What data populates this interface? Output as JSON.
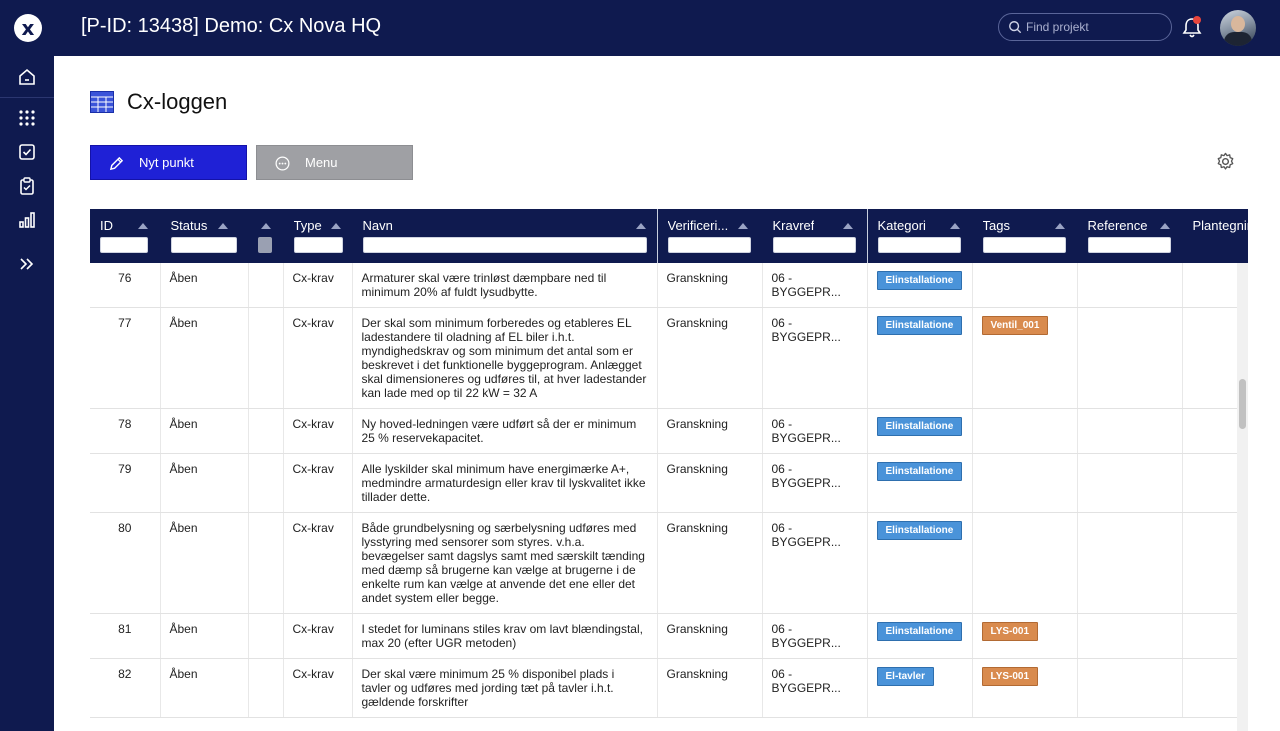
{
  "header": {
    "logo_label": "x",
    "title": "[P-ID: 13438] Demo: Cx Nova HQ",
    "search_placeholder": "Find projekt"
  },
  "page": {
    "title": "Cx-loggen"
  },
  "toolbar": {
    "new_label": "Nyt punkt",
    "menu_label": "Menu"
  },
  "table": {
    "columns": [
      {
        "label": "ID"
      },
      {
        "label": "Status"
      },
      {
        "label": ""
      },
      {
        "label": "Type"
      },
      {
        "label": "Navn"
      },
      {
        "label": "Verificeri..."
      },
      {
        "label": "Kravref"
      },
      {
        "label": "Kategori"
      },
      {
        "label": "Tags"
      },
      {
        "label": "Reference"
      },
      {
        "label": "Plantegnin"
      }
    ],
    "rows": [
      {
        "id": "76",
        "status": "Åben",
        "type": "Cx-krav",
        "name": "Armaturer skal være trinløst dæmpbare ned til minimum 20% af fuldt lysudbytte.",
        "verification": "Granskning",
        "kravref": "06 - BYGGEPR...",
        "category": "Elinstallatione",
        "tag": ""
      },
      {
        "id": "77",
        "status": "Åben",
        "type": "Cx-krav",
        "name": "Der skal som minimum forberedes og etableres EL ladestandere til oladning af EL biler i.h.t. myndighedskrav og som minimum det antal som er beskrevet i det funktionelle byggeprogram. Anlægget skal dimensioneres og udføres til, at hver ladestander kan lade med op til 22 kW = 32 A",
        "verification": "Granskning",
        "kravref": "06 - BYGGEPR...",
        "category": "Elinstallatione",
        "tag": "Ventil_001"
      },
      {
        "id": "78",
        "status": "Åben",
        "type": "Cx-krav",
        "name": "Ny hoved-ledningen være udført så der er minimum 25 % reservekapacitet.",
        "verification": "Granskning",
        "kravref": "06 - BYGGEPR...",
        "category": "Elinstallatione",
        "tag": ""
      },
      {
        "id": "79",
        "status": "Åben",
        "type": "Cx-krav",
        "name": "Alle lyskilder skal minimum have energimærke A+, medmindre armaturdesign eller krav til lyskvalitet ikke tillader dette.",
        "verification": "Granskning",
        "kravref": "06 - BYGGEPR...",
        "category": "Elinstallatione",
        "tag": ""
      },
      {
        "id": "80",
        "status": "Åben",
        "type": "Cx-krav",
        "name": "Både grundbelysning og særbelysning udføres med lysstyring med sensorer som styres. v.h.a. bevægelser samt dagslys samt med særskilt tænding med dæmp så brugerne kan vælge at brugerne i de enkelte rum kan vælge at anvende det ene eller det andet system eller begge.",
        "verification": "Granskning",
        "kravref": "06 - BYGGEPR...",
        "category": "Elinstallatione",
        "tag": ""
      },
      {
        "id": "81",
        "status": "Åben",
        "type": "Cx-krav",
        "name": "I stedet for luminans stiles krav om lavt blændingstal, max 20 (efter UGR metoden)",
        "verification": "Granskning",
        "kravref": "06 - BYGGEPR...",
        "category": "Elinstallatione",
        "tag": "LYS-001"
      },
      {
        "id": "82",
        "status": "Åben",
        "type": "Cx-krav",
        "name": " Der skal være minimum 25 % disponibel plads i tavler og udføres med jording tæt på tavler i.h.t. gældende forskrifter",
        "verification": "Granskning",
        "kravref": "06 - BYGGEPR...",
        "category": "El-tavler",
        "tag": "LYS-001"
      }
    ]
  },
  "colors": {
    "navy": "#0f1a4f",
    "primary_button": "#1f21d6",
    "menu_button": "#9fa0a4",
    "category_tag": "#4a93d9",
    "tag_orange": "#d98b4e",
    "notification_dot": "#e8453c"
  },
  "icons": {
    "sidebar": [
      "home-icon",
      "apps-grid-icon",
      "checkbox-icon",
      "clipboard-check-icon",
      "bar-chart-icon",
      "expand-chevrons-icon"
    ]
  }
}
